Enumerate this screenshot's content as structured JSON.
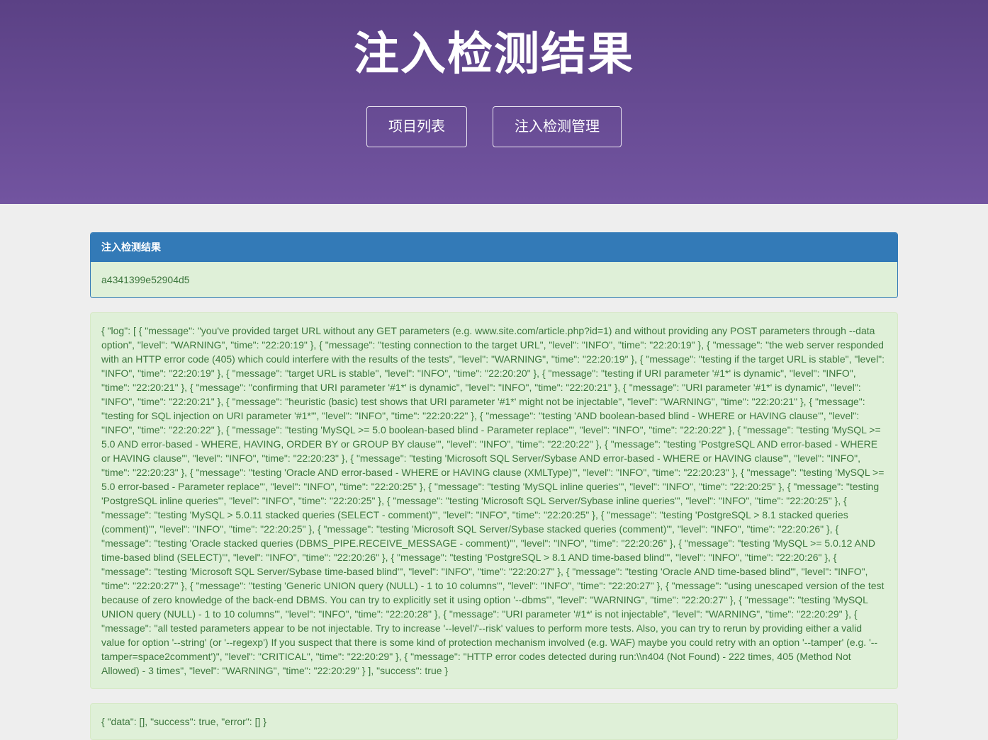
{
  "header": {
    "title": "注入检测结果",
    "buttons": [
      {
        "label": "项目列表"
      },
      {
        "label": "注入检测管理"
      }
    ]
  },
  "result_panel": {
    "heading": "注入检测结果",
    "task_id": "a4341399e52904d5"
  },
  "log_block": {
    "text": "{ \"log\": [ { \"message\": \"you've provided target URL without any GET parameters (e.g. www.site.com/article.php?id=1) and without providing any POST parameters through --data option\", \"level\": \"WARNING\", \"time\": \"22:20:19\" }, { \"message\": \"testing connection to the target URL\", \"level\": \"INFO\", \"time\": \"22:20:19\" }, { \"message\": \"the web server responded with an HTTP error code (405) which could interfere with the results of the tests\", \"level\": \"WARNING\", \"time\": \"22:20:19\" }, { \"message\": \"testing if the target URL is stable\", \"level\": \"INFO\", \"time\": \"22:20:19\" }, { \"message\": \"target URL is stable\", \"level\": \"INFO\", \"time\": \"22:20:20\" }, { \"message\": \"testing if URI parameter '#1*' is dynamic\", \"level\": \"INFO\", \"time\": \"22:20:21\" }, { \"message\": \"confirming that URI parameter '#1*' is dynamic\", \"level\": \"INFO\", \"time\": \"22:20:21\" }, { \"message\": \"URI parameter '#1*' is dynamic\", \"level\": \"INFO\", \"time\": \"22:20:21\" }, { \"message\": \"heuristic (basic) test shows that URI parameter '#1*' might not be injectable\", \"level\": \"WARNING\", \"time\": \"22:20:21\" }, { \"message\": \"testing for SQL injection on URI parameter '#1*'\", \"level\": \"INFO\", \"time\": \"22:20:22\" }, { \"message\": \"testing 'AND boolean-based blind - WHERE or HAVING clause'\", \"level\": \"INFO\", \"time\": \"22:20:22\" }, { \"message\": \"testing 'MySQL >= 5.0 boolean-based blind - Parameter replace'\", \"level\": \"INFO\", \"time\": \"22:20:22\" }, { \"message\": \"testing 'MySQL >= 5.0 AND error-based - WHERE, HAVING, ORDER BY or GROUP BY clause'\", \"level\": \"INFO\", \"time\": \"22:20:22\" }, { \"message\": \"testing 'PostgreSQL AND error-based - WHERE or HAVING clause'\", \"level\": \"INFO\", \"time\": \"22:20:23\" }, { \"message\": \"testing 'Microsoft SQL Server/Sybase AND error-based - WHERE or HAVING clause'\", \"level\": \"INFO\", \"time\": \"22:20:23\" }, { \"message\": \"testing 'Oracle AND error-based - WHERE or HAVING clause (XMLType)'\", \"level\": \"INFO\", \"time\": \"22:20:23\" }, { \"message\": \"testing 'MySQL >= 5.0 error-based - Parameter replace'\", \"level\": \"INFO\", \"time\": \"22:20:25\" }, { \"message\": \"testing 'MySQL inline queries'\", \"level\": \"INFO\", \"time\": \"22:20:25\" }, { \"message\": \"testing 'PostgreSQL inline queries'\", \"level\": \"INFO\", \"time\": \"22:20:25\" }, { \"message\": \"testing 'Microsoft SQL Server/Sybase inline queries'\", \"level\": \"INFO\", \"time\": \"22:20:25\" }, { \"message\": \"testing 'MySQL > 5.0.11 stacked queries (SELECT - comment)'\", \"level\": \"INFO\", \"time\": \"22:20:25\" }, { \"message\": \"testing 'PostgreSQL > 8.1 stacked queries (comment)'\", \"level\": \"INFO\", \"time\": \"22:20:25\" }, { \"message\": \"testing 'Microsoft SQL Server/Sybase stacked queries (comment)'\", \"level\": \"INFO\", \"time\": \"22:20:26\" }, { \"message\": \"testing 'Oracle stacked queries (DBMS_PIPE.RECEIVE_MESSAGE - comment)'\", \"level\": \"INFO\", \"time\": \"22:20:26\" }, { \"message\": \"testing 'MySQL >= 5.0.12 AND time-based blind (SELECT)'\", \"level\": \"INFO\", \"time\": \"22:20:26\" }, { \"message\": \"testing 'PostgreSQL > 8.1 AND time-based blind'\", \"level\": \"INFO\", \"time\": \"22:20:26\" }, { \"message\": \"testing 'Microsoft SQL Server/Sybase time-based blind'\", \"level\": \"INFO\", \"time\": \"22:20:27\" }, { \"message\": \"testing 'Oracle AND time-based blind'\", \"level\": \"INFO\", \"time\": \"22:20:27\" }, { \"message\": \"testing 'Generic UNION query (NULL) - 1 to 10 columns'\", \"level\": \"INFO\", \"time\": \"22:20:27\" }, { \"message\": \"using unescaped version of the test because of zero knowledge of the back-end DBMS. You can try to explicitly set it using option '--dbms'\", \"level\": \"WARNING\", \"time\": \"22:20:27\" }, { \"message\": \"testing 'MySQL UNION query (NULL) - 1 to 10 columns'\", \"level\": \"INFO\", \"time\": \"22:20:28\" }, { \"message\": \"URI parameter '#1*' is not injectable\", \"level\": \"WARNING\", \"time\": \"22:20:29\" }, { \"message\": \"all tested parameters appear to be not injectable. Try to increase '--level'/'--risk' values to perform more tests. Also, you can try to rerun by providing either a valid value for option '--string' (or '--regexp') If you suspect that there is some kind of protection mechanism involved (e.g. WAF) maybe you could retry with an option '--tamper' (e.g. '--tamper=space2comment')\", \"level\": \"CRITICAL\", \"time\": \"22:20:29\" }, { \"message\": \"HTTP error codes detected during run:\\\\n404 (Not Found) - 222 times, 405 (Method Not Allowed) - 3 times\", \"level\": \"WARNING\", \"time\": \"22:20:29\" } ], \"success\": true }"
  },
  "data_block": {
    "text": "{ \"data\": [], \"success\": true, \"error\": [] }"
  },
  "colors": {
    "header_gradient_top": "#5b4185",
    "header_gradient_bottom": "#7254a0",
    "panel_heading": "#337ab7",
    "panel_body": "#dff0d8",
    "text_green": "#3c763d",
    "page_bg": "#eeeeee"
  }
}
